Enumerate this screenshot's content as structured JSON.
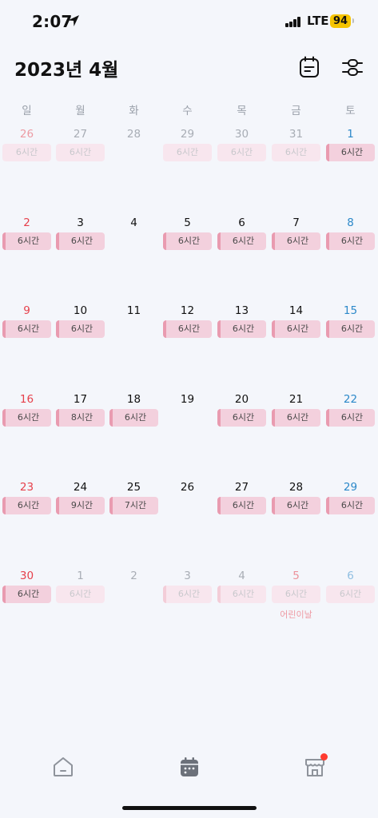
{
  "status_bar": {
    "time": "2:07",
    "network": "LTE",
    "battery": "94"
  },
  "header": {
    "title": "2023년 4월",
    "icons": [
      "calendar-note-icon",
      "filter-sliders-icon"
    ]
  },
  "weekdays": [
    "일",
    "월",
    "화",
    "수",
    "목",
    "금",
    "토"
  ],
  "colors": {
    "sunday": "#e6404b",
    "saturday": "#2b88c9",
    "chip_bg": "#f3d0dd",
    "chip_bar": "#e99bb0",
    "badge": "#ff3b30"
  },
  "weeks": [
    [
      {
        "day": "26",
        "other": true,
        "chip": "6시간",
        "bar": false
      },
      {
        "day": "27",
        "other": true,
        "chip": "6시간",
        "bar": false
      },
      {
        "day": "28",
        "other": true
      },
      {
        "day": "29",
        "other": true,
        "chip": "6시간",
        "bar": false
      },
      {
        "day": "30",
        "other": true,
        "chip": "6시간",
        "bar": false
      },
      {
        "day": "31",
        "other": true,
        "chip": "6시간",
        "bar": false
      },
      {
        "day": "1",
        "chip": "6시간",
        "bar": true
      }
    ],
    [
      {
        "day": "2",
        "chip": "6시간",
        "bar": true
      },
      {
        "day": "3",
        "chip": "6시간",
        "bar": true
      },
      {
        "day": "4"
      },
      {
        "day": "5",
        "chip": "6시간",
        "bar": true
      },
      {
        "day": "6",
        "chip": "6시간",
        "bar": true
      },
      {
        "day": "7",
        "chip": "6시간",
        "bar": true
      },
      {
        "day": "8",
        "chip": "6시간",
        "bar": true
      }
    ],
    [
      {
        "day": "9",
        "chip": "6시간",
        "bar": true
      },
      {
        "day": "10",
        "chip": "6시간",
        "bar": true
      },
      {
        "day": "11"
      },
      {
        "day": "12",
        "chip": "6시간",
        "bar": true
      },
      {
        "day": "13",
        "chip": "6시간",
        "bar": true
      },
      {
        "day": "14",
        "chip": "6시간",
        "bar": true
      },
      {
        "day": "15",
        "chip": "6시간",
        "bar": true
      }
    ],
    [
      {
        "day": "16",
        "chip": "6시간",
        "bar": true
      },
      {
        "day": "17",
        "chip": "8시간",
        "bar": true
      },
      {
        "day": "18",
        "chip": "6시간",
        "bar": true
      },
      {
        "day": "19"
      },
      {
        "day": "20",
        "chip": "6시간",
        "bar": true
      },
      {
        "day": "21",
        "chip": "6시간",
        "bar": true
      },
      {
        "day": "22",
        "chip": "6시간",
        "bar": true
      }
    ],
    [
      {
        "day": "23",
        "chip": "6시간",
        "bar": true
      },
      {
        "day": "24",
        "chip": "9시간",
        "bar": true
      },
      {
        "day": "25",
        "chip": "7시간",
        "bar": true
      },
      {
        "day": "26"
      },
      {
        "day": "27",
        "chip": "6시간",
        "bar": true
      },
      {
        "day": "28",
        "chip": "6시간",
        "bar": true
      },
      {
        "day": "29",
        "chip": "6시간",
        "bar": true
      }
    ],
    [
      {
        "day": "30",
        "chip": "6시간",
        "bar": true
      },
      {
        "day": "1",
        "other": true,
        "chip": "6시간",
        "bar": false
      },
      {
        "day": "2",
        "other": true
      },
      {
        "day": "3",
        "other": true,
        "chip": "6시간",
        "bar": true
      },
      {
        "day": "4",
        "other": true,
        "chip": "6시간",
        "bar": true
      },
      {
        "day": "5",
        "other": true,
        "chip": "6시간",
        "bar": false,
        "holiday": "어린이날"
      },
      {
        "day": "6",
        "other": true,
        "chip": "6시간",
        "bar": false
      }
    ]
  ],
  "tab_bar": {
    "items": [
      "home-icon",
      "calendar-icon",
      "store-icon"
    ],
    "active": "calendar-icon"
  }
}
